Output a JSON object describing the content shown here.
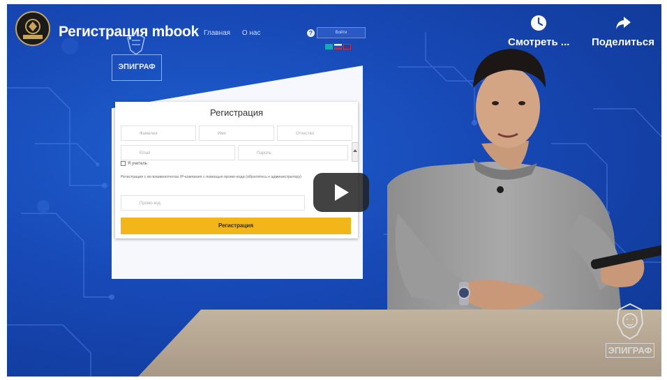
{
  "video": {
    "title": "Регистрация mbook",
    "controls": {
      "watch_later_label": "Смотреть ...",
      "watch_later_icon": "clock-icon",
      "share_label": "Поделиться",
      "share_icon": "share-arrow-icon"
    },
    "play_icon": "play-icon",
    "channel_avatar_icon": "channel-logo-icon",
    "watermark_text": "ЭПИГРАФ",
    "colors": {
      "background": "#1748b5",
      "submit": "#f2b61b",
      "play": "#212121"
    }
  },
  "embedded_site": {
    "nav": [
      "Главная",
      "О нас"
    ],
    "logo_text": "ЭПИГРАФ",
    "login_placeholder": "Войти",
    "help_icon": "?",
    "form": {
      "title": "Регистрация",
      "fields_row1": [
        "Фамилия",
        "Имя",
        "Отчество"
      ],
      "fields_row2": [
        "Email",
        "Пароль"
      ],
      "checkbox_label": "Я учитель",
      "note": "Регистрация с во взаимоотнотах IP-компания с помощью промо-кода (обратитесь к администратору)",
      "promo_placeholder": "Промо-код",
      "submit_label": "Регистрация"
    }
  }
}
